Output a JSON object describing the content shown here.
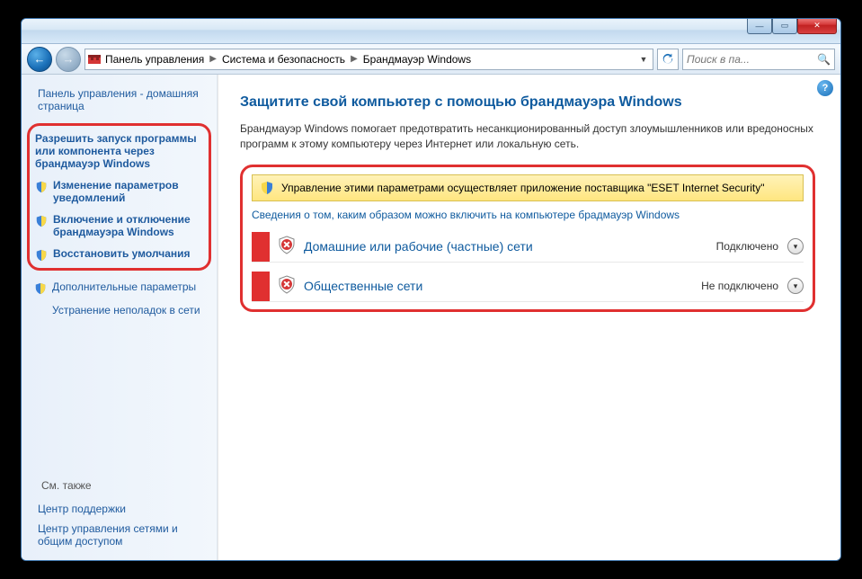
{
  "titlebar": {
    "min": "—",
    "max": "▭",
    "close": "✕"
  },
  "navbar": {
    "back": "←",
    "fwd": "→",
    "breadcrumb": [
      {
        "label": "Панель управления"
      },
      {
        "label": "Система и безопасность"
      },
      {
        "label": "Брандмауэр Windows"
      }
    ],
    "drop": "▼",
    "refresh": "↻",
    "search_placeholder": "Поиск в па...",
    "search_icon": "🔍"
  },
  "sidebar": {
    "title": "Панель управления - домашняя страница",
    "highlighted": [
      {
        "label": "Разрешить запуск программы или компонента через брандмауэр Windows",
        "bold": true,
        "shield": false
      },
      {
        "label": "Изменение параметров уведомлений",
        "bold": true,
        "shield": true
      },
      {
        "label": "Включение и отключение брандмауэра Windows",
        "bold": true,
        "shield": true
      },
      {
        "label": "Восстановить умолчания",
        "bold": true,
        "shield": true
      }
    ],
    "extra": [
      {
        "label": "Дополнительные параметры",
        "shield": true
      },
      {
        "label": "Устранение неполадок в сети",
        "shield": false
      }
    ],
    "see_also": "См. также",
    "bottom": [
      {
        "label": "Центр поддержки"
      },
      {
        "label": "Центр управления сетями и общим доступом"
      }
    ]
  },
  "main": {
    "help": "?",
    "title": "Защитите свой компьютер с помощью брандмауэра Windows",
    "desc": "Брандмауэр Windows помогает предотвратить несанкционированный доступ злоумышленников или вредоносных программ к этому компьютеру через Интернет или локальную сеть.",
    "info_bar": "Управление этими параметрами осуществляет приложение поставщика \"ESET Internet Security\"",
    "info_link": "Сведения о том, каким образом можно включить на компьютере брадмауэр Windows",
    "networks": [
      {
        "title": "Домашние или рабочие (частные) сети",
        "status": "Подключено"
      },
      {
        "title": "Общественные сети",
        "status": "Не подключено"
      }
    ]
  }
}
